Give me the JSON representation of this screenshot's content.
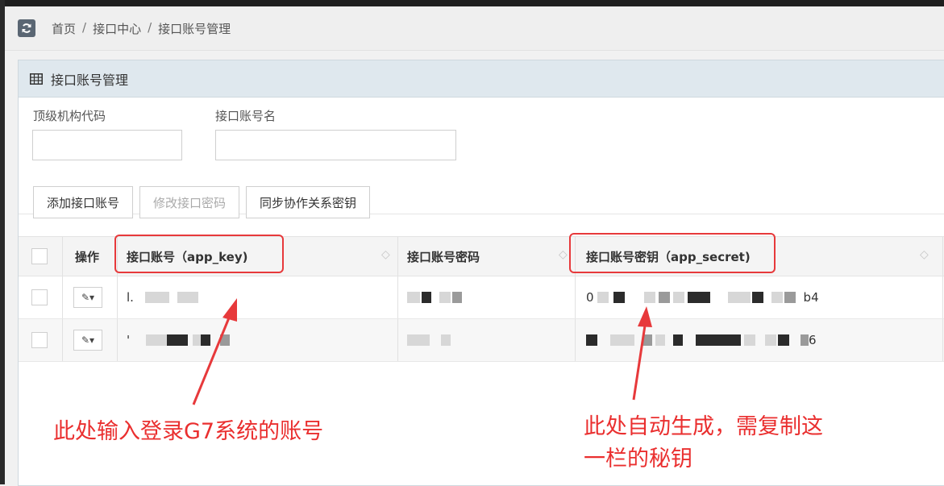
{
  "breadcrumb": {
    "items": [
      "首页",
      "接口中心",
      "接口账号管理"
    ],
    "separator": "/"
  },
  "panel": {
    "title": "接口账号管理"
  },
  "search": {
    "field1_label": "顶级机构代码",
    "field1_value": "",
    "field2_label": "接口账号名",
    "field2_value": ""
  },
  "toolbar": {
    "add_label": "添加接口账号",
    "edit_pwd_label": "修改接口密码",
    "sync_label": "同步协作关系密钥"
  },
  "table": {
    "headers": {
      "op": "操作",
      "app_key": "接口账号（app_key)",
      "password": "接口账号密码",
      "app_secret": "接口账号密钥（app_secret)"
    },
    "rows": [
      {
        "app_key_prefix": "l.",
        "app_secret_prefix": "0",
        "app_secret_suffix": "b4"
      },
      {
        "app_key_prefix": "'",
        "app_secret_prefix": "",
        "app_secret_suffix": "6"
      }
    ]
  },
  "annotations": {
    "left_note": "此处输入登录G7系统的账号",
    "right_note_line1": "此处自动生成，需复制这",
    "right_note_line2": "一栏的秘钥",
    "color": "#e7393b"
  },
  "colors": {
    "panel_header_bg": "#dfe8ee",
    "page_bg": "#f1f1f1"
  }
}
